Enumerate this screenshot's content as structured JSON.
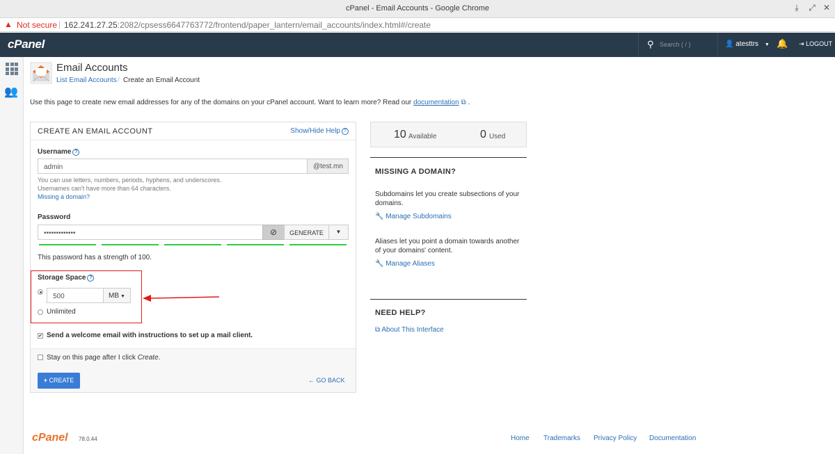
{
  "browser": {
    "window_title": "cPanel - Email Accounts - Google Chrome",
    "not_secure": "Not secure",
    "url_host": "162.241.27.25",
    "url_path": ":2082/cpsess6647763772/frontend/paper_lantern/email_accounts/index.html#/create"
  },
  "topnav": {
    "logo": "cPanel",
    "search_placeholder": "Search ( / )",
    "user": "atesttrs",
    "logout": "LOGOUT"
  },
  "header": {
    "title": "Email Accounts",
    "breadcrumb_link": "List Email Accounts",
    "breadcrumb_sep": "/",
    "breadcrumb_current": "Create an Email Account",
    "intro_text": "Use this page to create new email addresses for any of the domains on your cPanel account. Want to learn more? Read our ",
    "intro_link": "documentation",
    "intro_end": " ."
  },
  "form": {
    "panel_title": "CREATE AN EMAIL ACCOUNT",
    "show_hide_help": "Show/Hide Help",
    "username_label": "Username",
    "username_value": "admin",
    "domain_addon": "@test.mn",
    "username_help_1": "You can use letters, numbers, periods, hyphens, and underscores.",
    "username_help_2": "Usernames can't have more than 64 characters.",
    "missing_domain_link": "Missing a domain?",
    "password_label": "Password",
    "password_value": "•••••••••••••",
    "generate_label": "GENERATE",
    "strength_text": "This password has a strength of 100.",
    "strength_percent": 100,
    "storage_label": "Storage Space",
    "storage_value": "500",
    "storage_unit": "MB",
    "unlimited_label": "Unlimited",
    "welcome_email_label": "Send a welcome email with instructions to set up a mail client.",
    "welcome_email_checked": true,
    "stay_label_pre": "Stay on this page after I click ",
    "stay_label_em": "Create",
    "stay_label_post": ".",
    "stay_checked": false,
    "create_label": "CREATE",
    "go_back_label": "GO BACK"
  },
  "stats": {
    "available_count": "10",
    "available_label": "Available",
    "used_count": "0",
    "used_label": "Used"
  },
  "sidebar": {
    "missing_domain_title": "MISSING A DOMAIN?",
    "subdomains_text": "Subdomains let you create subsections of your domains.",
    "manage_subdomains": "Manage Subdomains",
    "aliases_text": "Aliases let you point a domain towards another of your domains' content.",
    "manage_aliases": "Manage Aliases",
    "need_help_title": "NEED HELP?",
    "about_interface": "About This Interface"
  },
  "footer": {
    "logo": "cPanel",
    "version": "78.0.44",
    "links": [
      "Home",
      "Trademarks",
      "Privacy Policy",
      "Documentation"
    ]
  },
  "colors": {
    "nav_bg": "#293a4a",
    "link": "#2b6fb5",
    "create_button": "#3a7cd6",
    "strength_bar": "#2ecc40",
    "annotation_red": "#e01b1b",
    "footer_logo": "#e8732a"
  }
}
